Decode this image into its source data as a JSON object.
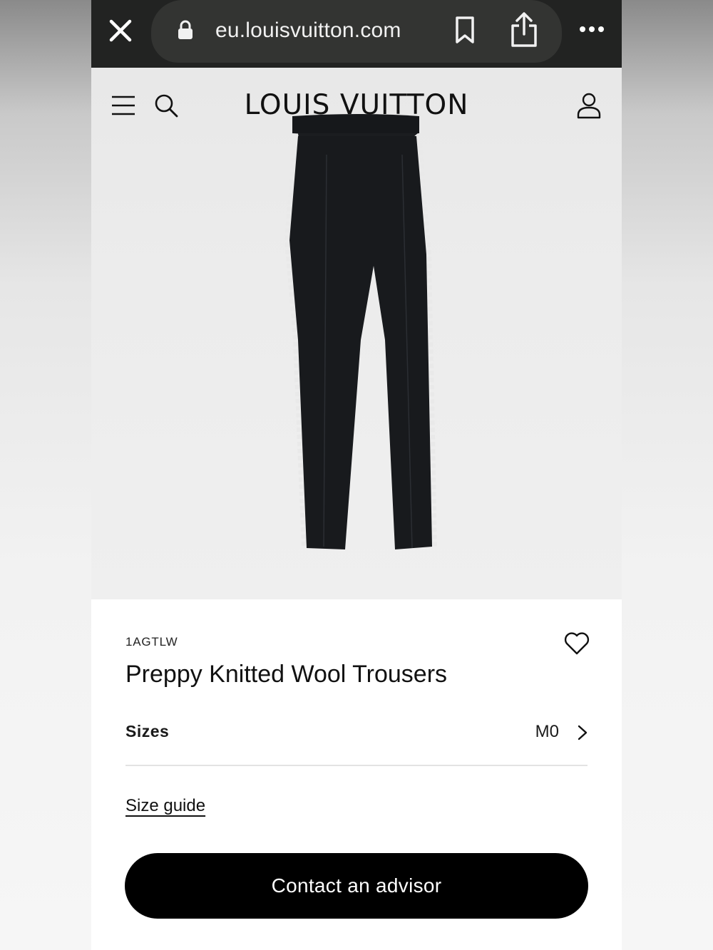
{
  "browser": {
    "url": "eu.louisvuitton.com"
  },
  "header": {
    "brand": "LOUIS VUITTON"
  },
  "product": {
    "sku": "1AGTLW",
    "title": "Preppy Knitted Wool Trousers",
    "sizes_label": "Sizes",
    "selected_size": "M0",
    "size_guide_label": "Size guide",
    "contact_label": "Contact an advisor"
  },
  "icons": {
    "close": "close-icon",
    "lock": "lock-icon",
    "bookmark": "bookmark-icon",
    "share": "share-icon",
    "more": "more-icon",
    "menu": "menu-icon",
    "search": "search-icon",
    "account": "account-icon",
    "wishlist": "heart-icon",
    "chevron": "chevron-right-icon"
  },
  "colors": {
    "browser_bar": "#222322",
    "url_pill": "#333432",
    "button": "#000000",
    "page_bg": "#ececec"
  }
}
